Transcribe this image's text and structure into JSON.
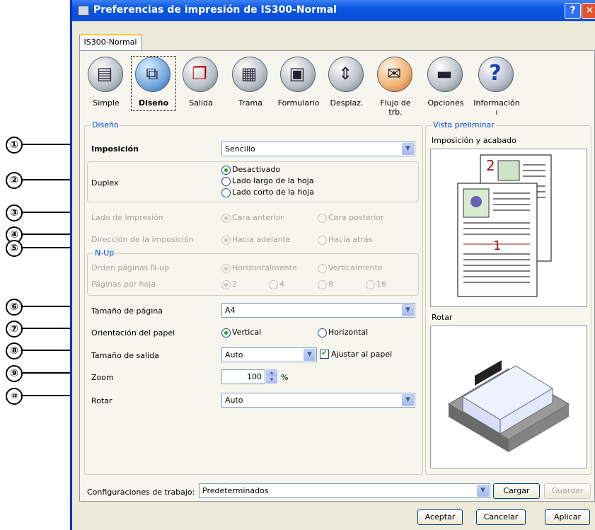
{
  "window": {
    "title": "Preferencias de impresión de IS300-Normal",
    "help_glyph": "?",
    "close_glyph": "✕"
  },
  "tabs": [
    {
      "label": "IS300-Normal"
    }
  ],
  "toolbar": {
    "items": [
      {
        "label": "Simple",
        "icon": "page-icon"
      },
      {
        "label": "Diseño",
        "icon": "layout-icon",
        "selected": true
      },
      {
        "label": "Salida",
        "icon": "output-icon"
      },
      {
        "label": "Trama",
        "icon": "screen-icon"
      },
      {
        "label": "Formulario",
        "icon": "form-icon"
      },
      {
        "label": "Desplaz.",
        "icon": "shift-icon"
      },
      {
        "label": "Flujo de trb.",
        "icon": "workflow-icon"
      },
      {
        "label": "Opciones",
        "icon": "options-icon"
      },
      {
        "label": "Información ı",
        "icon": "info-icon"
      }
    ]
  },
  "callouts": [
    "①",
    "②",
    "③",
    "④",
    "⑤",
    "⑥",
    "⑦",
    "⑧",
    "⑨",
    "⑩"
  ],
  "layout_group": {
    "legend": "Diseño",
    "imposicion": {
      "label": "Imposición",
      "value": "Sencillo"
    },
    "duplex": {
      "label": "Duplex",
      "options": [
        "Desactivado",
        "Lado largo de la hoja",
        "Lado corto de la hoja"
      ],
      "selected": 0
    },
    "lado": {
      "label": "Lado de impresión",
      "options": [
        "Cara anterior",
        "Cara posterior"
      ],
      "selected": 0
    },
    "direccion": {
      "label": "Dirección de la imposición",
      "options": [
        "Hacia adelante",
        "Hacia atrás"
      ],
      "selected": 0
    },
    "nup": {
      "legend": "N-Up",
      "orden": {
        "label": "Orden páginas N-up",
        "options": [
          "Horizontalmente",
          "Verticalmente"
        ],
        "selected": 0
      },
      "paginas": {
        "label": "Páginas por hoja",
        "options": [
          "2",
          "4",
          "8",
          "16"
        ],
        "selected": 0
      }
    },
    "tamano": {
      "label": "Tamaño de página",
      "value": "A4"
    },
    "orientacion": {
      "label": "Orientación del papel",
      "options": [
        "Vertical",
        "Horizontal"
      ],
      "selected": 0
    },
    "salida": {
      "label": "Tamaño de salida",
      "value": "Auto",
      "check_label": "Ajustar al papel",
      "checked": true
    },
    "zoom": {
      "label": "Zoom",
      "value": "100",
      "unit": "%"
    },
    "rotar": {
      "label": "Rotar",
      "value": "Auto"
    }
  },
  "preview": {
    "legend": "Vista preliminar",
    "imposicion_label": "Imposición y acabado",
    "page1_number": "1",
    "page2_number": "2",
    "rotar_label": "Rotar"
  },
  "footer": {
    "config_label": "Configuraciones de trabajo:",
    "config_value": "Predeterminados",
    "cargar": "Cargar",
    "guardar": "Guardar",
    "aceptar": "Aceptar",
    "cancelar": "Cancelar",
    "aplicar": "Aplicar"
  }
}
